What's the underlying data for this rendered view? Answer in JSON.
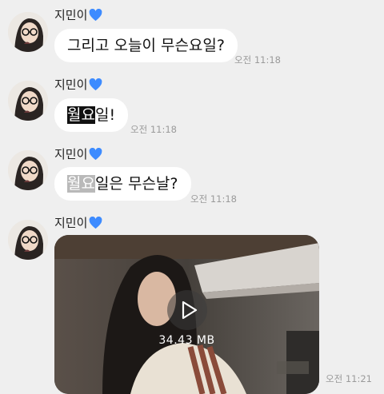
{
  "sender_name": "지민이",
  "messages": [
    {
      "text_parts": [
        "그리고 오늘이 무슨요일?"
      ],
      "time": "오전 11:18"
    },
    {
      "highlight": "월요",
      "rest": "일!",
      "time": "오전 11:18"
    },
    {
      "highlight": "월요",
      "rest": "일은 무슨날?",
      "time": "오전 11:18"
    },
    {
      "video_size": "34.43 MB",
      "time": "오전 11:21"
    }
  ],
  "colors": {
    "heart": "#3d8bff",
    "bubble": "#ffffff",
    "background": "#efefef"
  }
}
